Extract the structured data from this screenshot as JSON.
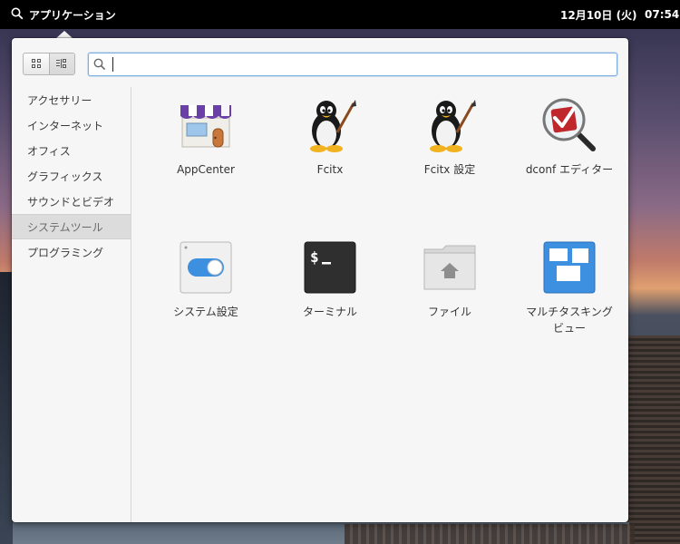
{
  "panel": {
    "applications_label": "アプリケーション",
    "date": "12月10日 (火)",
    "time": "07:54"
  },
  "search": {
    "placeholder": "",
    "value": ""
  },
  "view_toggle": {
    "grid_icon": "grid-view-icon",
    "list_icon": "category-view-icon"
  },
  "categories": [
    {
      "label": "アクセサリー"
    },
    {
      "label": "インターネット"
    },
    {
      "label": "オフィス"
    },
    {
      "label": "グラフィックス"
    },
    {
      "label": "サウンドとビデオ"
    },
    {
      "label": "システムツール",
      "active": true
    },
    {
      "label": "プログラミング"
    }
  ],
  "apps": [
    {
      "label": "AppCenter",
      "icon": "appcenter-icon"
    },
    {
      "label": "Fcitx",
      "icon": "fcitx-penguin-icon"
    },
    {
      "label": "Fcitx 設定",
      "icon": "fcitx-settings-penguin-icon"
    },
    {
      "label": "dconf エディター",
      "icon": "dconf-editor-icon"
    },
    {
      "label": "システム設定",
      "icon": "system-settings-icon"
    },
    {
      "label": "ターミナル",
      "icon": "terminal-icon"
    },
    {
      "label": "ファイル",
      "icon": "files-icon"
    },
    {
      "label": "マルチタスキングビュー",
      "label_line1": "マルチタスキング",
      "label_line2": "ビュー",
      "icon": "multitasking-view-icon"
    }
  ],
  "colors": {
    "accent": "#3d8fe0",
    "panel": "#000000"
  }
}
